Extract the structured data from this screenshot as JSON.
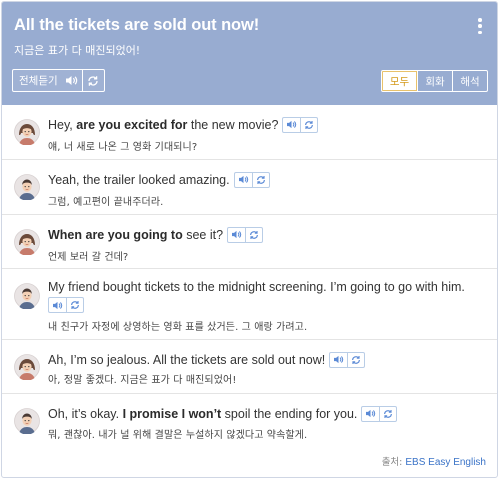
{
  "header": {
    "title": "All the tickets are sold out now!",
    "subtitle": "지금은 표가 다 매진되었어!",
    "play_all_label": "전체듣기",
    "tabs": [
      {
        "label": "모두",
        "active": true
      },
      {
        "label": "회화",
        "active": false
      },
      {
        "label": "해석",
        "active": false
      }
    ]
  },
  "colors": {
    "header_bg": "#98acd1",
    "active_tab_text": "#d49a1c",
    "control_border": "#b9cde6",
    "control_icon": "#5b8ad6",
    "source_link": "#3a73c7"
  },
  "dialogue": [
    {
      "speaker": "female",
      "en": [
        {
          "t": "Hey, "
        },
        {
          "t": "are you excited for",
          "b": true
        },
        {
          "t": " the new movie?"
        }
      ],
      "ko": "얘, 너 새로 나온 그 영화 기대되니?"
    },
    {
      "speaker": "male",
      "en": [
        {
          "t": "Yeah, the trailer looked amazing."
        }
      ],
      "ko": "그럼, 예고편이 끝내주더라."
    },
    {
      "speaker": "female",
      "en": [
        {
          "t": "When are you going to",
          "b": true
        },
        {
          "t": " see it?"
        }
      ],
      "ko": "언제 보러 갈 건데?"
    },
    {
      "speaker": "male",
      "en": [
        {
          "t": "My friend bought tickets to the midnight screening. I’m going to go with him."
        }
      ],
      "ko": "내 친구가 자정에 상영하는 영화 표를 샀거든. 그 애랑 가려고."
    },
    {
      "speaker": "female",
      "en": [
        {
          "t": "Ah, I’m so jealous. All the tickets are sold out now!"
        }
      ],
      "ko": "아, 정말 좋겠다. 지금은 표가 다 매진되었어!"
    },
    {
      "speaker": "male",
      "en": [
        {
          "t": "Oh, it’s okay. "
        },
        {
          "t": "I promise I won’t",
          "b": true
        },
        {
          "t": " spoil the ending for you."
        }
      ],
      "ko": "뭐, 괜찮아. 내가 널 위해 결말은 누설하지 않겠다고 약속할게."
    }
  ],
  "icons": {
    "speaker": "speaker-icon",
    "repeat": "repeat-icon",
    "menu": "kebab-menu-icon"
  },
  "footer": {
    "label": "출처: ",
    "source": "EBS Easy English"
  }
}
